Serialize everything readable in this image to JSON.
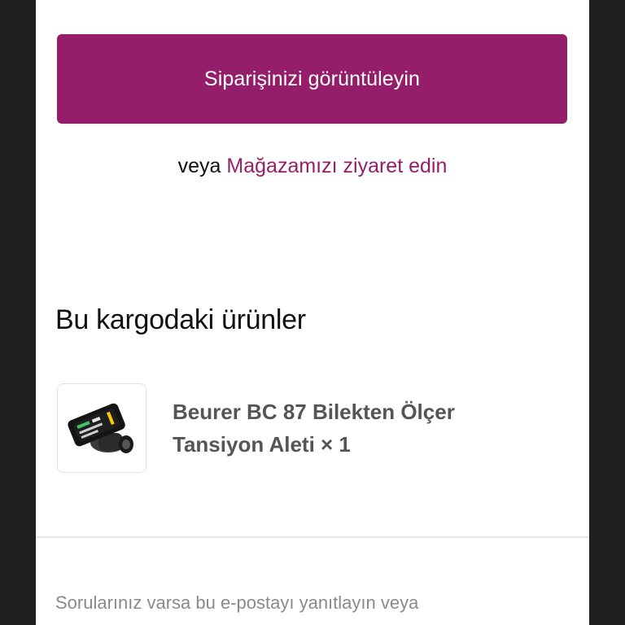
{
  "actions": {
    "view_order_label": "Siparişinizi görüntüleyin",
    "or_text": "veya",
    "visit_store_label": "Mağazamızı ziyaret edin"
  },
  "shipment": {
    "title": "Bu kargodaki ürünler",
    "items": [
      {
        "name_line1": "Beurer BC 87 Bilekten Ölçer",
        "name_line2": "Tansiyon Aleti × 1"
      }
    ]
  },
  "footer": {
    "text": "Sorularınız varsa bu e-postayı yanıtlayın veya"
  },
  "colors": {
    "accent": "#951e6a",
    "background": "#ffffff",
    "frame": "#1f1f1f"
  }
}
